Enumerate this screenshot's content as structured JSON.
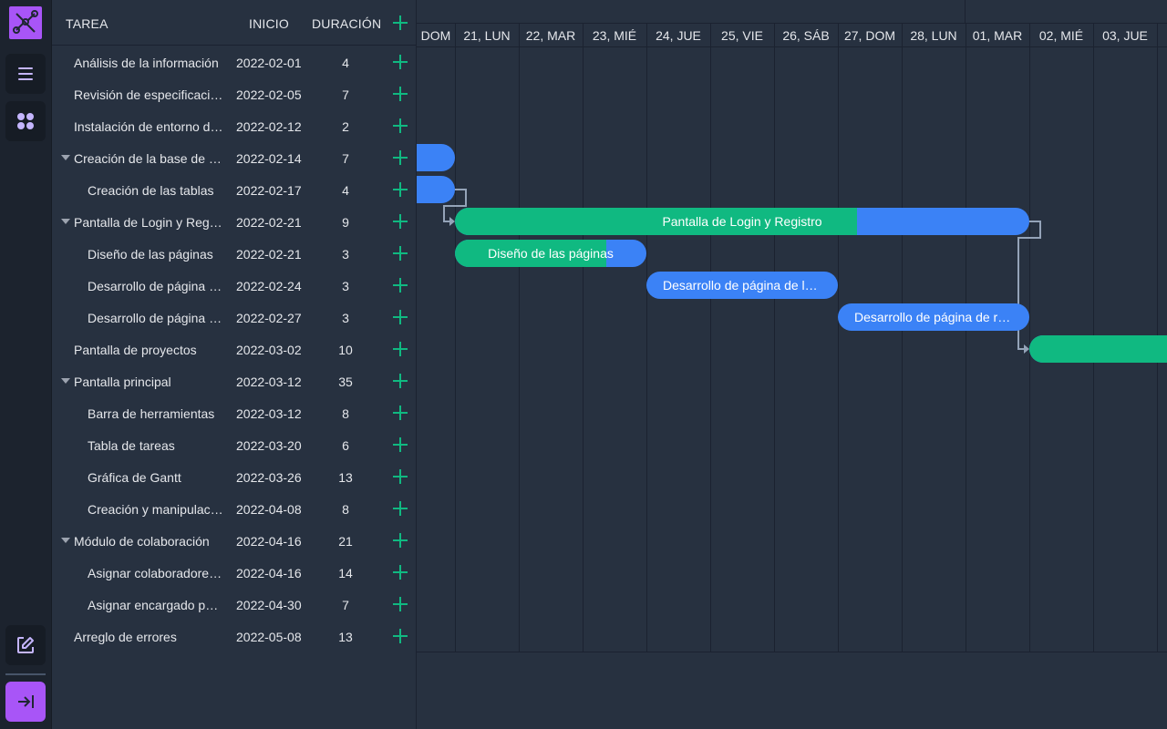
{
  "rail": {
    "logo_icon": "gantt-logo-icon",
    "buttons": [
      {
        "name": "menu-button",
        "icon": "hamburger-icon"
      },
      {
        "name": "apps-button",
        "icon": "grid-dots-icon"
      },
      {
        "name": "edit-button",
        "icon": "edit-icon"
      },
      {
        "name": "logout-button",
        "icon": "logout-icon"
      }
    ]
  },
  "grid": {
    "columns": {
      "task": "TAREA",
      "start": "INICIO",
      "duration": "DURACIÓN"
    },
    "rows": [
      {
        "name": "Análisis de la información",
        "start": "2022-02-01",
        "duration": "4",
        "level": 0,
        "parent": false
      },
      {
        "name": "Revisión de especificaciones",
        "start": "2022-02-05",
        "duration": "7",
        "level": 0,
        "parent": false
      },
      {
        "name": "Instalación de entorno de desarrollo",
        "start": "2022-02-12",
        "duration": "2",
        "level": 0,
        "parent": false
      },
      {
        "name": "Creación de la base de datos",
        "start": "2022-02-14",
        "duration": "7",
        "level": 0,
        "parent": true
      },
      {
        "name": "Creación de las tablas",
        "start": "2022-02-17",
        "duration": "4",
        "level": 1,
        "parent": false
      },
      {
        "name": "Pantalla de Login y Registro",
        "start": "2022-02-21",
        "duration": "9",
        "level": 0,
        "parent": true
      },
      {
        "name": "Diseño de las páginas",
        "start": "2022-02-21",
        "duration": "3",
        "level": 1,
        "parent": false
      },
      {
        "name": "Desarrollo de página de login",
        "start": "2022-02-24",
        "duration": "3",
        "level": 1,
        "parent": false
      },
      {
        "name": "Desarrollo de página de registro",
        "start": "2022-02-27",
        "duration": "3",
        "level": 1,
        "parent": false
      },
      {
        "name": "Pantalla de proyectos",
        "start": "2022-03-02",
        "duration": "10",
        "level": 0,
        "parent": false
      },
      {
        "name": "Pantalla principal",
        "start": "2022-03-12",
        "duration": "35",
        "level": 0,
        "parent": true
      },
      {
        "name": "Barra de herramientas",
        "start": "2022-03-12",
        "duration": "8",
        "level": 1,
        "parent": false
      },
      {
        "name": "Tabla de tareas",
        "start": "2022-03-20",
        "duration": "6",
        "level": 1,
        "parent": false
      },
      {
        "name": "Gráfica de Gantt",
        "start": "2022-03-26",
        "duration": "13",
        "level": 1,
        "parent": false
      },
      {
        "name": "Creación y manipulación de tareas",
        "start": "2022-04-08",
        "duration": "8",
        "level": 1,
        "parent": false
      },
      {
        "name": "Módulo de colaboración",
        "start": "2022-04-16",
        "duration": "21",
        "level": 0,
        "parent": true
      },
      {
        "name": "Asignar colaboradores al proyecto",
        "start": "2022-04-16",
        "duration": "14",
        "level": 1,
        "parent": false
      },
      {
        "name": "Asignar encargado por tarea",
        "start": "2022-04-30",
        "duration": "7",
        "level": 1,
        "parent": false
      },
      {
        "name": "Arreglo de errores",
        "start": "2022-05-08",
        "duration": "13",
        "level": 0,
        "parent": false
      }
    ]
  },
  "scale": {
    "days": [
      "DOM",
      "21, LUN",
      "22, MAR",
      "23, MIÉ",
      "24, JUE",
      "25, VIE",
      "26, SÁB",
      "27, DOM",
      "28, LUN",
      "01, MAR",
      "02, MIÉ",
      "03, JUE"
    ]
  },
  "bars": [
    {
      "row": 3,
      "label": "",
      "progress": 0
    },
    {
      "row": 4,
      "label": "",
      "progress": 0
    },
    {
      "row": 5,
      "label": "Pantalla de Login y Registro",
      "progress": 0.7
    },
    {
      "row": 6,
      "label": "Diseño de las páginas",
      "progress": 0.79
    },
    {
      "row": 7,
      "label": "Desarrollo de página de login",
      "progress": 0
    },
    {
      "row": 8,
      "label": "Desarrollo de página de registro",
      "progress": 0
    },
    {
      "row": 9,
      "label": "",
      "progress": 1
    }
  ],
  "colors": {
    "task": "#3b82f6",
    "progress": "#10b981",
    "accent": "#a855f7",
    "background": "#273140"
  }
}
